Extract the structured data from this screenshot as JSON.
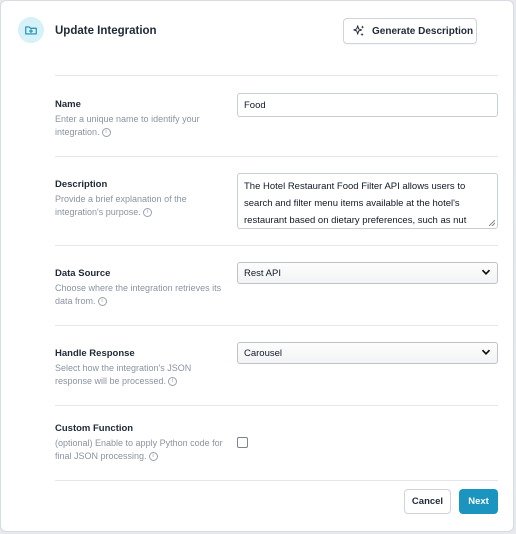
{
  "dialog": {
    "title": "Update Integration",
    "header_icon": "folder-plus-icon",
    "generate_button": {
      "label": "Generate Description",
      "icon": "sparkles-icon"
    }
  },
  "fields": {
    "name": {
      "label": "Name",
      "help": "Enter a unique name to identify your integration.",
      "value": "Food"
    },
    "description": {
      "label": "Description",
      "help": "Provide a brief explanation of the integration's purpose.",
      "lines": [
        "The Hotel Restaurant Food Filter API allows users to",
        "search and filter menu items available at the hotel's",
        "restaurant based on dietary preferences, such as nut"
      ]
    },
    "data_source": {
      "label": "Data Source",
      "help": "Choose where the integration retrieves its data from.",
      "selected": "Rest API"
    },
    "handle_response": {
      "label": "Handle Response",
      "help": "Select how the integration's JSON response will be processed.",
      "selected": "Carousel"
    },
    "custom_function": {
      "label": "Custom Function",
      "help": "(optional) Enable to apply Python code for final JSON processing.",
      "checked": false
    }
  },
  "footer": {
    "cancel_label": "Cancel",
    "next_label": "Next"
  },
  "colors": {
    "accent": "#1b95c0",
    "icon_bg": "#d6f1f7",
    "icon_fg": "#1b8fb0",
    "help_text": "#8b93a1",
    "divider": "#e5e7eb"
  }
}
